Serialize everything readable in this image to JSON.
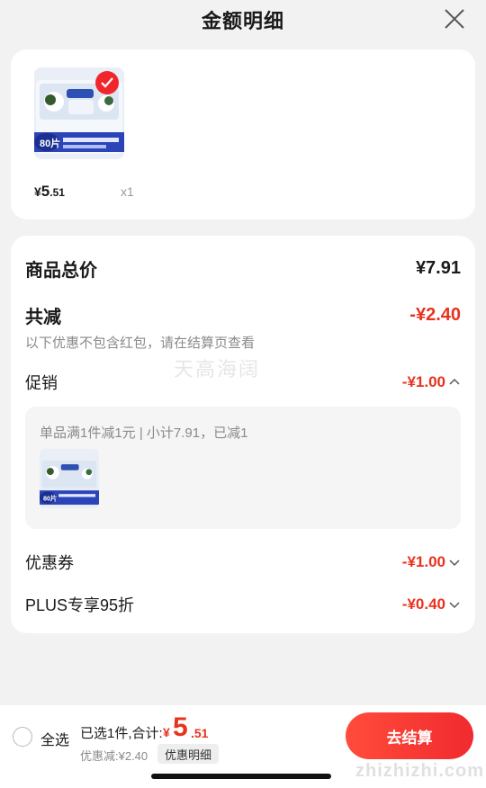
{
  "header": {
    "title": "金额明细",
    "close_icon": "close-icon"
  },
  "product": {
    "price_yen": "¥",
    "price_int": "5",
    "price_dec": ".51",
    "qty": "x1",
    "pack_text": "80片",
    "selected": true
  },
  "detail": {
    "total_label": "商品总价",
    "total_value": "¥7.91",
    "reduce_label": "共减",
    "reduce_value": "-¥2.40",
    "note": "以下优惠不包含红包，请在结算页查看",
    "promo_label": "促销",
    "promo_value": "-¥1.00",
    "promo_desc": "单品满1件减1元 | 小计7.91，已减1",
    "coupon_label": "优惠券",
    "coupon_value": "-¥1.00",
    "plus_label": "PLUS专享95折",
    "plus_value": "-¥0.40"
  },
  "watermark": "天高海阔",
  "bottom": {
    "select_all": "全选",
    "summary": "已选1件,合计:",
    "total_yen": "¥",
    "total_int": "5",
    "total_dec": ".51",
    "discount": "优惠减:¥2.40",
    "detail_button": "优惠明细",
    "checkout_button": "去结算",
    "site_mark": "zhizhizhi.com"
  },
  "colors": {
    "accent_red": "#e8321e",
    "checkout_red": "#f12a2f"
  }
}
